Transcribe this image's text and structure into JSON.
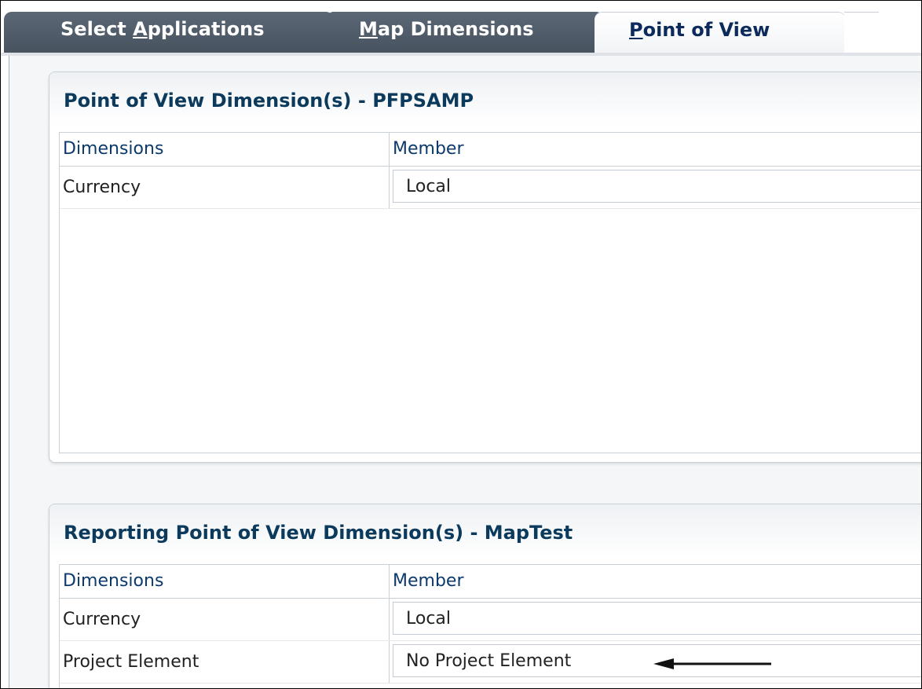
{
  "tabs": [
    {
      "pre": "Select ",
      "mnemonic": "A",
      "post": "pplications",
      "active": false
    },
    {
      "pre": "",
      "mnemonic": "M",
      "post": "ap Dimensions",
      "active": false
    },
    {
      "pre": "",
      "mnemonic": "P",
      "post": "oint of View",
      "active": true
    }
  ],
  "pov_panel": {
    "title": "Point of View Dimension(s) - PFPSAMP",
    "col_dimensions": "Dimensions",
    "col_member": "Member",
    "rows": [
      {
        "dimension": "Currency",
        "member": "Local"
      }
    ]
  },
  "reporting_panel": {
    "title": "Reporting Point of View Dimension(s) - MapTest",
    "col_dimensions": "Dimensions",
    "col_member": "Member",
    "rows": [
      {
        "dimension": "Currency",
        "member": "Local"
      },
      {
        "dimension": "Project Element",
        "member": "No Project Element"
      }
    ]
  },
  "colors": {
    "tab_inactive": "#4f5b69",
    "tab_active_text": "#0c2a5c",
    "title_text": "#0c3a5c",
    "header_text": "#0c3a6c"
  },
  "annotation": {
    "icon": "left-arrow-icon"
  }
}
